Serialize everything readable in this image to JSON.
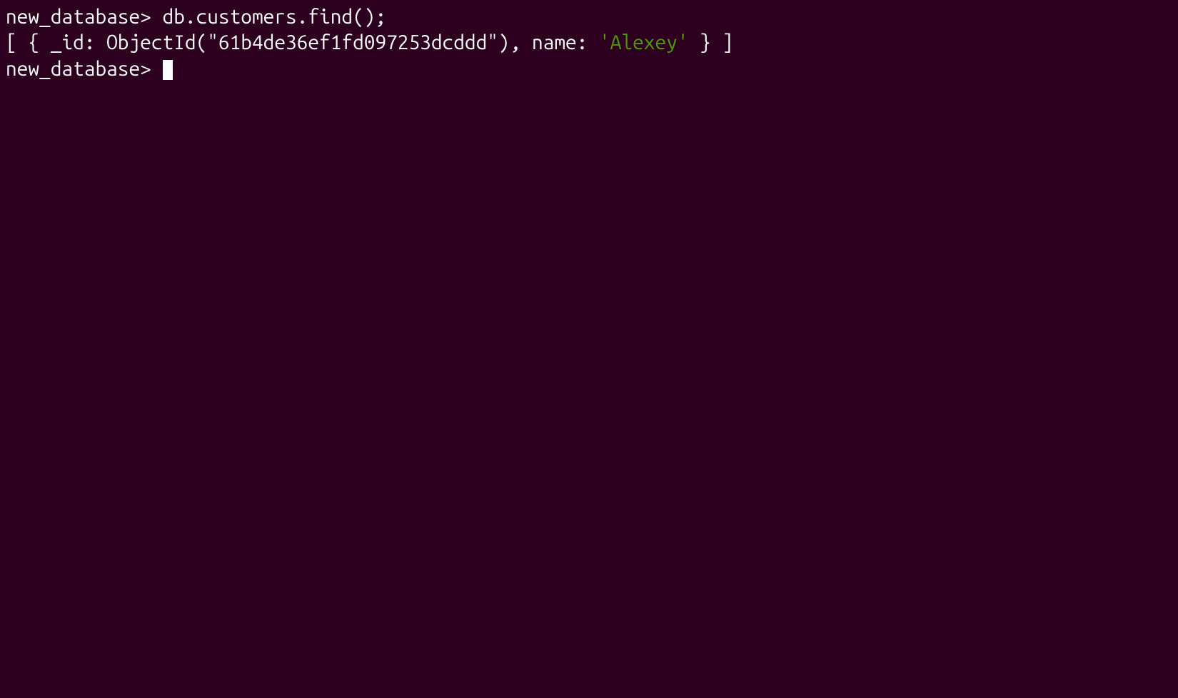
{
  "lines": [
    {
      "prompt": "new_database> ",
      "command": "db.customers.find();"
    }
  ],
  "output": {
    "prefix": "[ { _id: ObjectId(\"61b4de36ef1fd097253dcddd\"), name: ",
    "value": "'Alexey'",
    "suffix": " } ]"
  },
  "cursor_prompt": "new_database> "
}
